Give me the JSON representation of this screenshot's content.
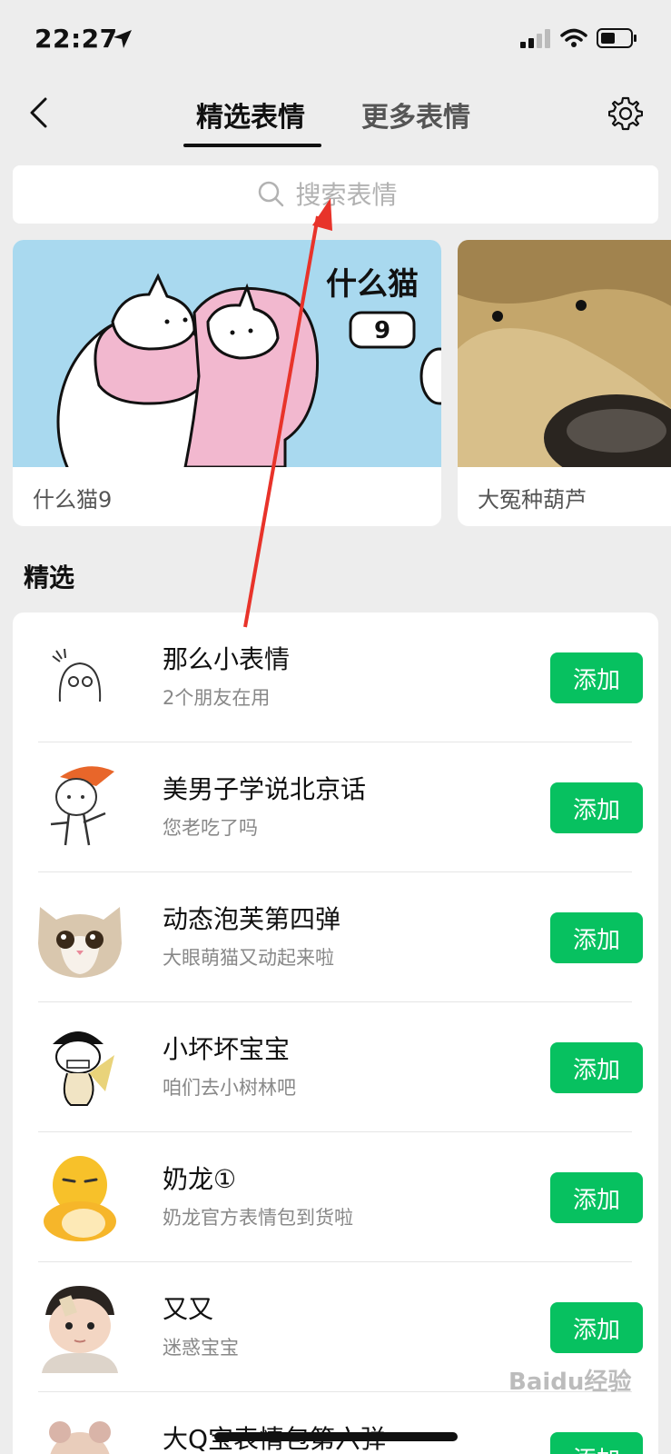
{
  "status_bar": {
    "time": "22:27"
  },
  "nav": {
    "tabs": [
      {
        "label": "精选表情",
        "active": true
      },
      {
        "label": "更多表情",
        "active": false
      }
    ]
  },
  "search": {
    "placeholder": "搜索表情"
  },
  "banners": [
    {
      "title": "什么猫9",
      "image_text": "什么猫",
      "image_badge": "9"
    },
    {
      "title": "大冤种葫芦"
    }
  ],
  "section": {
    "title": "精选"
  },
  "items": [
    {
      "name": "那么小表情",
      "desc": "2个朋友在用",
      "button": "添加"
    },
    {
      "name": "美男子学说北京话",
      "desc": "您老吃了吗",
      "button": "添加"
    },
    {
      "name": "动态泡芙第四弹",
      "desc": "大眼萌猫又动起来啦",
      "button": "添加"
    },
    {
      "name": "小坏坏宝宝",
      "desc": "咱们去小树林吧",
      "button": "添加"
    },
    {
      "name": "奶龙①",
      "desc": "奶龙官方表情包到货啦",
      "button": "添加"
    },
    {
      "name": "又又",
      "desc": "迷惑宝宝",
      "button": "添加"
    },
    {
      "name": "大Q宝表情包第六弹",
      "desc": "",
      "button": "添加"
    }
  ],
  "watermark": "Baidu经验",
  "colors": {
    "accent": "#07c160",
    "background": "#ededed",
    "arrow": "#e8332a"
  }
}
